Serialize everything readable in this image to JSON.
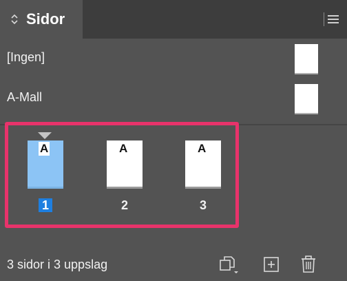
{
  "panel": {
    "title": "Sidor",
    "menu_icon": "hamburger-menu-icon",
    "tab_icon": "up-down-arrows-icon"
  },
  "masters": [
    {
      "label": "[Ingen]"
    },
    {
      "label": "A-Mall"
    }
  ],
  "pages": [
    {
      "number": "1",
      "master": "A",
      "selected": true
    },
    {
      "number": "2",
      "master": "A",
      "selected": false
    },
    {
      "number": "3",
      "master": "A",
      "selected": false
    }
  ],
  "footer": {
    "status": "3 sidor i 3 uppslag",
    "icons": [
      "page-size-icon",
      "new-page-icon",
      "trash-icon"
    ]
  },
  "colors": {
    "highlight": "#e8336b",
    "selected_page": "#8cc4f5",
    "selected_number": "#1e7fe0",
    "panel_bg": "#535353"
  }
}
